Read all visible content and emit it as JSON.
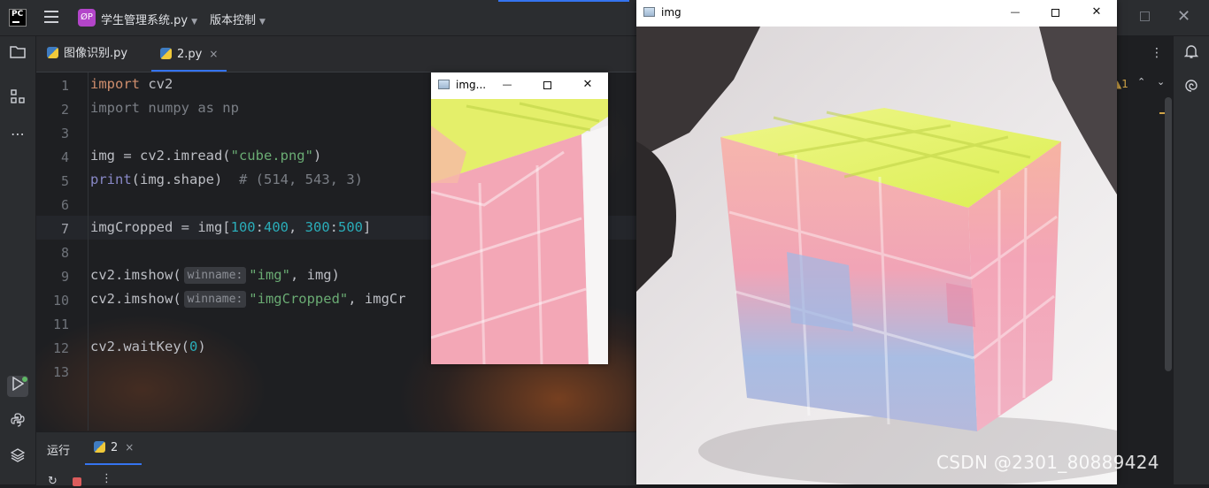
{
  "titlebar": {
    "logo": "PC",
    "project_badge": "ØP",
    "project_name": "学生管理系统.py",
    "vcs_label": "版本控制"
  },
  "editor": {
    "tabs": [
      {
        "label": "图像识别.py",
        "active": false
      },
      {
        "label": "2.py",
        "active": true
      }
    ],
    "tab_close_glyph": "×",
    "line_numbers": [
      "1",
      "2",
      "3",
      "4",
      "5",
      "6",
      "7",
      "8",
      "9",
      "10",
      "11",
      "12",
      "13"
    ],
    "current_line": "7",
    "code": {
      "l1_kw": "import",
      "l1_rest": " cv2",
      "l2": "import numpy as np",
      "l4_a": "img = cv2.imread(",
      "l4_str": "\"cube.png\"",
      "l4_b": ")",
      "l5_fn": "print",
      "l5_a": "(img.shape)  ",
      "l5_cmt": "# (514, 543, 3)",
      "l7_a": "imgCropped = img[",
      "l7_n1": "100",
      "l7_c1": ":",
      "l7_n2": "400",
      "l7_c2": ", ",
      "l7_n3": "300",
      "l7_c3": ":",
      "l7_n4": "500",
      "l7_b": "]",
      "l9_a": "cv2.imshow(",
      "l9_hint": "winname:",
      "l9_str": "\"img\"",
      "l9_b": ", img)",
      "l10_a": "cv2.imshow(",
      "l10_hint": "winname:",
      "l10_str": "\"imgCropped\"",
      "l10_b": ", imgCr",
      "l12_a": "cv2.waitKey(",
      "l12_num": "0",
      "l12_b": ")"
    }
  },
  "run_panel": {
    "label": "运行",
    "tab": "2",
    "close_glyph": "×"
  },
  "right_indicator": "▲1",
  "window_small": {
    "title": "img...",
    "minimize": "—",
    "close": "✕"
  },
  "window_big": {
    "title": "img",
    "minimize": "—",
    "close": "✕"
  },
  "watermark": "CSDN @2301_80889424",
  "colors": {
    "accent": "#3574f0",
    "keyword": "#cf8e6d",
    "string": "#6aab73",
    "number": "#2aacb8",
    "cube_top": "#e9f56a",
    "cube_pink": "#f2a6b8",
    "cube_blue": "#a9bde3"
  }
}
